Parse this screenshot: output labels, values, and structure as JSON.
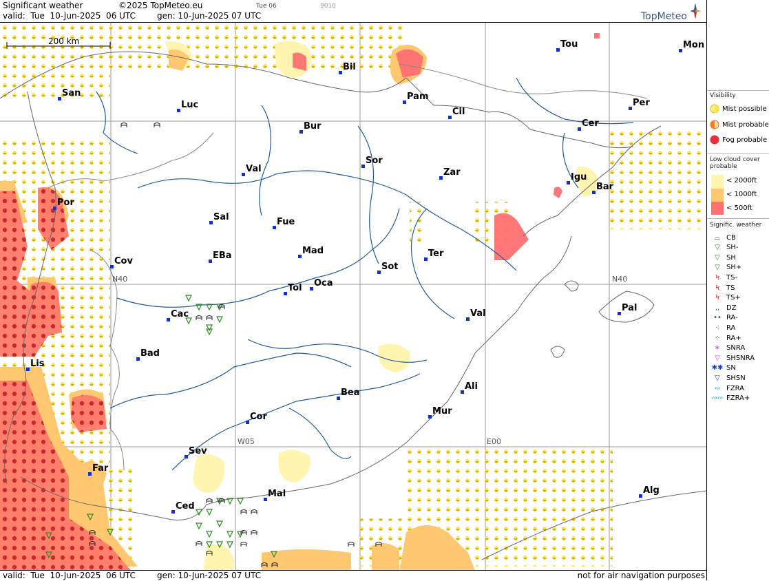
{
  "header": {
    "title": "Significant weather",
    "copyright": "©2025 TopMeteo.eu",
    "valid": "valid:  Tue  10-Jun-2025  06 UTC",
    "generated": "gen: 10-Jun-2025 07 UTC",
    "run_label": "Tue 06",
    "code": "9010",
    "brand": "TopMeteo"
  },
  "scale_bar": "200 km",
  "grid_labels": [
    "N40",
    "N40",
    "W05",
    "E00"
  ],
  "cities": [
    {
      "name": "San"
    },
    {
      "name": "Luc"
    },
    {
      "name": "Bil"
    },
    {
      "name": "Pam"
    },
    {
      "name": "Tou"
    },
    {
      "name": "Mon"
    },
    {
      "name": "Cil"
    },
    {
      "name": "Per"
    },
    {
      "name": "Cer"
    },
    {
      "name": "Bur"
    },
    {
      "name": "Val"
    },
    {
      "name": "Sor"
    },
    {
      "name": "Zar"
    },
    {
      "name": "Igu"
    },
    {
      "name": "Bar"
    },
    {
      "name": "Por"
    },
    {
      "name": "Sal"
    },
    {
      "name": "Fue"
    },
    {
      "name": "Mad"
    },
    {
      "name": "Ter"
    },
    {
      "name": "Cov"
    },
    {
      "name": "EBa"
    },
    {
      "name": "Sot"
    },
    {
      "name": "Tol"
    },
    {
      "name": "Oca"
    },
    {
      "name": "Pal"
    },
    {
      "name": "Cac"
    },
    {
      "name": "Val"
    },
    {
      "name": "Bad"
    },
    {
      "name": "Lis"
    },
    {
      "name": "Ali"
    },
    {
      "name": "Bea"
    },
    {
      "name": "Mur"
    },
    {
      "name": "Cor"
    },
    {
      "name": "Sev"
    },
    {
      "name": "Far"
    },
    {
      "name": "Mal"
    },
    {
      "name": "Ced"
    },
    {
      "name": "Alg"
    }
  ],
  "legend": {
    "visibility_title": "Visibility",
    "visibility": [
      {
        "label": "Mist possible",
        "color": "#ffe54d"
      },
      {
        "label": "Mist probable",
        "color": "#ff9a2e"
      },
      {
        "label": "Fog probable",
        "color": "#e8303a"
      }
    ],
    "lowcloud_title": "Low cloud cover probable",
    "lowcloud": [
      {
        "label": "< 2000ft",
        "color": "#fff5b0"
      },
      {
        "label": "< 1000ft",
        "color": "#ffc870"
      },
      {
        "label": "< 500ft",
        "color": "#ff7070"
      }
    ],
    "sigwx_title": "Signific. weather",
    "sigwx": [
      {
        "label": "CB",
        "icon": "cb-icon",
        "color": "#333333"
      },
      {
        "label": "SH-",
        "icon": "shower-light-icon",
        "color": "#2e8b22"
      },
      {
        "label": "SH",
        "icon": "shower-icon",
        "color": "#2e8b22"
      },
      {
        "label": "SH+",
        "icon": "shower-heavy-icon",
        "color": "#2e8b22"
      },
      {
        "label": "TS-",
        "icon": "thunder-light-icon",
        "color": "#d42020"
      },
      {
        "label": "TS",
        "icon": "thunder-icon",
        "color": "#d42020"
      },
      {
        "label": "TS+",
        "icon": "thunder-heavy-icon",
        "color": "#d42020"
      },
      {
        "label": "DZ",
        "icon": "drizzle-icon",
        "color": "#1a6b1a"
      },
      {
        "label": "RA-",
        "icon": "rain-light-icon",
        "color": "#1a6b1a"
      },
      {
        "label": "RA",
        "icon": "rain-icon",
        "color": "#1a6b1a"
      },
      {
        "label": "RA+",
        "icon": "rain-heavy-icon",
        "color": "#1a6b1a"
      },
      {
        "label": "SNRA",
        "icon": "snow-rain-icon",
        "color": "#d040d0"
      },
      {
        "label": "SHSNRA",
        "icon": "snow-rain-shower-icon",
        "color": "#d040d0"
      },
      {
        "label": "SN",
        "icon": "snow-icon",
        "color": "#2040c0"
      },
      {
        "label": "SHSN",
        "icon": "snow-shower-icon",
        "color": "#2040c0"
      },
      {
        "label": "FZRA",
        "icon": "freezing-rain-icon",
        "color": "#20b0c0"
      },
      {
        "label": "FZRA+",
        "icon": "freezing-rain-heavy-icon",
        "color": "#20b0c0"
      }
    ]
  },
  "footer": {
    "valid": "valid:  Tue  10-Jun-2025  06 UTC",
    "generated": "gen: 10-Jun-2025 07 UTC",
    "disclaimer": "not for air navigation purposes"
  }
}
